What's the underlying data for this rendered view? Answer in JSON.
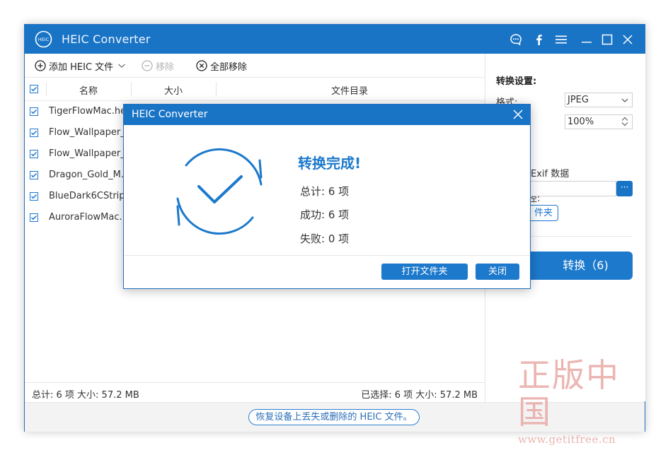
{
  "window": {
    "title": "HEIC Converter",
    "logo_text": "HEIC"
  },
  "toolbar": {
    "add_label": "添加 HEIC 文件",
    "remove_label": "移除",
    "remove_all_label": "全部移除"
  },
  "list": {
    "columns": [
      "名称",
      "大小",
      "文件目录"
    ],
    "files": [
      "TigerFlowMac.heic",
      "Flow_Wallpaper_...",
      "Flow_Wallpaper_...",
      "Dragon_Gold_M...",
      "BlueDark6CStrip...",
      "AuroraFlowMac..."
    ]
  },
  "settings": {
    "title": "转换设置:",
    "format_label": "格式:",
    "format_value": "JPEG",
    "quality_value": "100%",
    "exif_label": "Exif 数据",
    "path_label_tail": "径:",
    "browse_label": "···",
    "open_folder_partial": "件夹",
    "convert_label": "转换（6)"
  },
  "status": {
    "left": "总计: 6 项 大小: 57.2 MB",
    "right": "已选择: 6 项 大小: 57.2 MB"
  },
  "bottom": {
    "recover_label": "恢复设备上丢失或删除的 HEIC 文件。"
  },
  "dialog": {
    "title": "HEIC Converter",
    "heading": "转换完成!",
    "total": "总计: 6 项",
    "success": "成功: 6 项",
    "failed": "失败: 0 项",
    "open_folder_label": "打开文件夹",
    "close_label": "关闭"
  },
  "watermark": {
    "line1": "正版中国",
    "line2": "www.getitfree.cn"
  },
  "colors": {
    "accent": "#1974c6",
    "accent_button": "#1c79cc",
    "watermark": "#e8a9a5"
  }
}
